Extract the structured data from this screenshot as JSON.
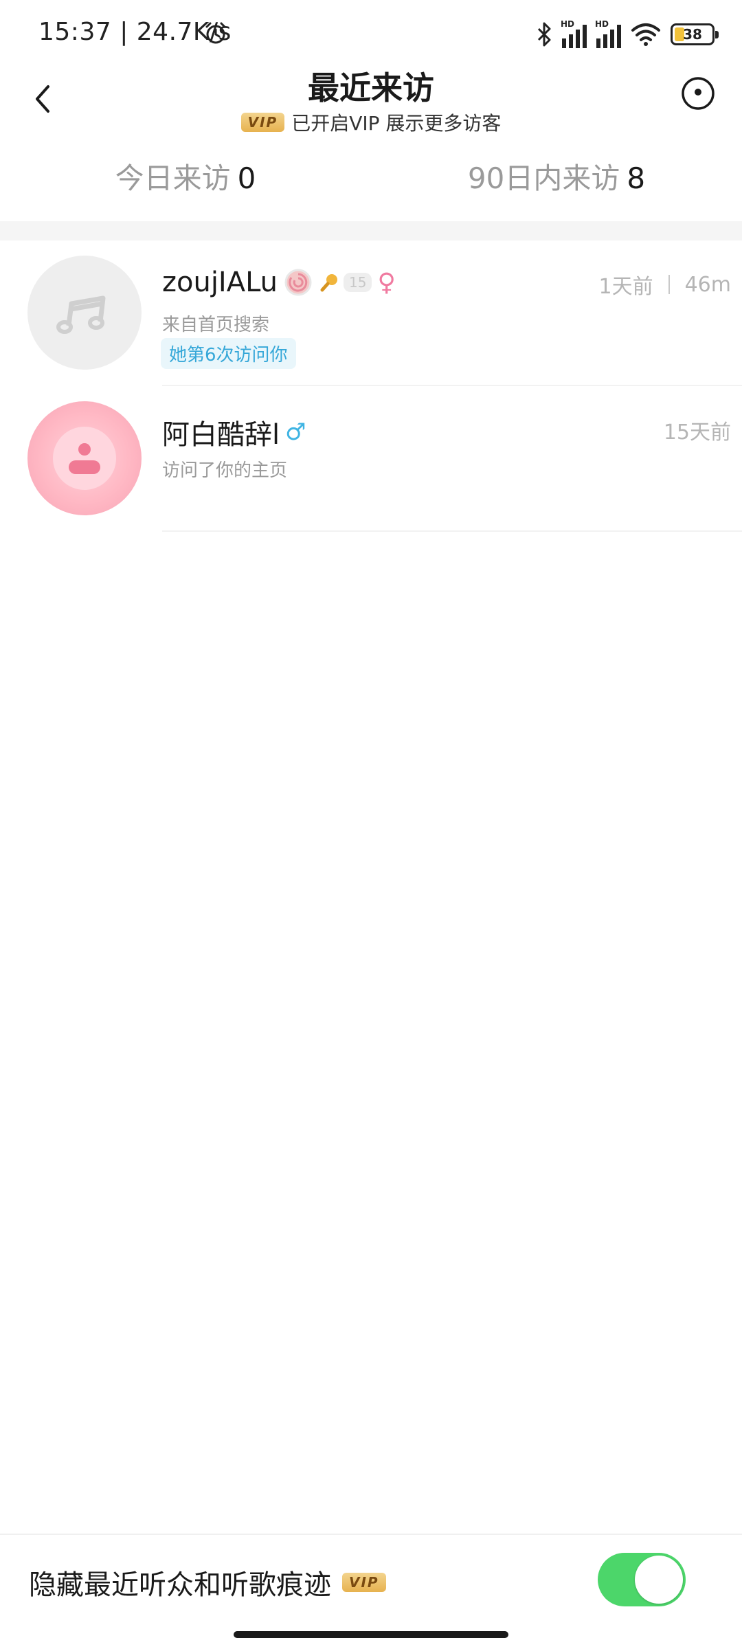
{
  "status_bar": {
    "time_speed": "15:37 | 24.7K/s",
    "hd1": "HD",
    "hd2": "HD",
    "battery": "38"
  },
  "header": {
    "title": "最近来访",
    "vip_badge": "VIP",
    "subtitle": "已开启VIP 展示更多访客"
  },
  "tabs": [
    {
      "label": "今日来访",
      "count": "0"
    },
    {
      "label": "90日内来访",
      "count": "8"
    }
  ],
  "visitors": [
    {
      "name": "zoujIALu",
      "level": "15",
      "gender": "♀",
      "time": "1天前",
      "duration": "46m",
      "source": "来自首页搜索",
      "tag": "她第6次访问你"
    },
    {
      "name": "阿白酷辞l",
      "gender": "♂",
      "time": "15天前",
      "source": "访问了你的主页"
    }
  ],
  "bottom": {
    "label": "隐藏最近听众和听歌痕迹",
    "vip_badge": "VIP",
    "toggle_on": true
  },
  "colors": {
    "toggle_green": "#4cd66a",
    "tag_blue": "#35a7d8",
    "vip_gold": "#e7b24f",
    "female_pink": "#f07aa0",
    "male_blue": "#3fb4e3"
  }
}
